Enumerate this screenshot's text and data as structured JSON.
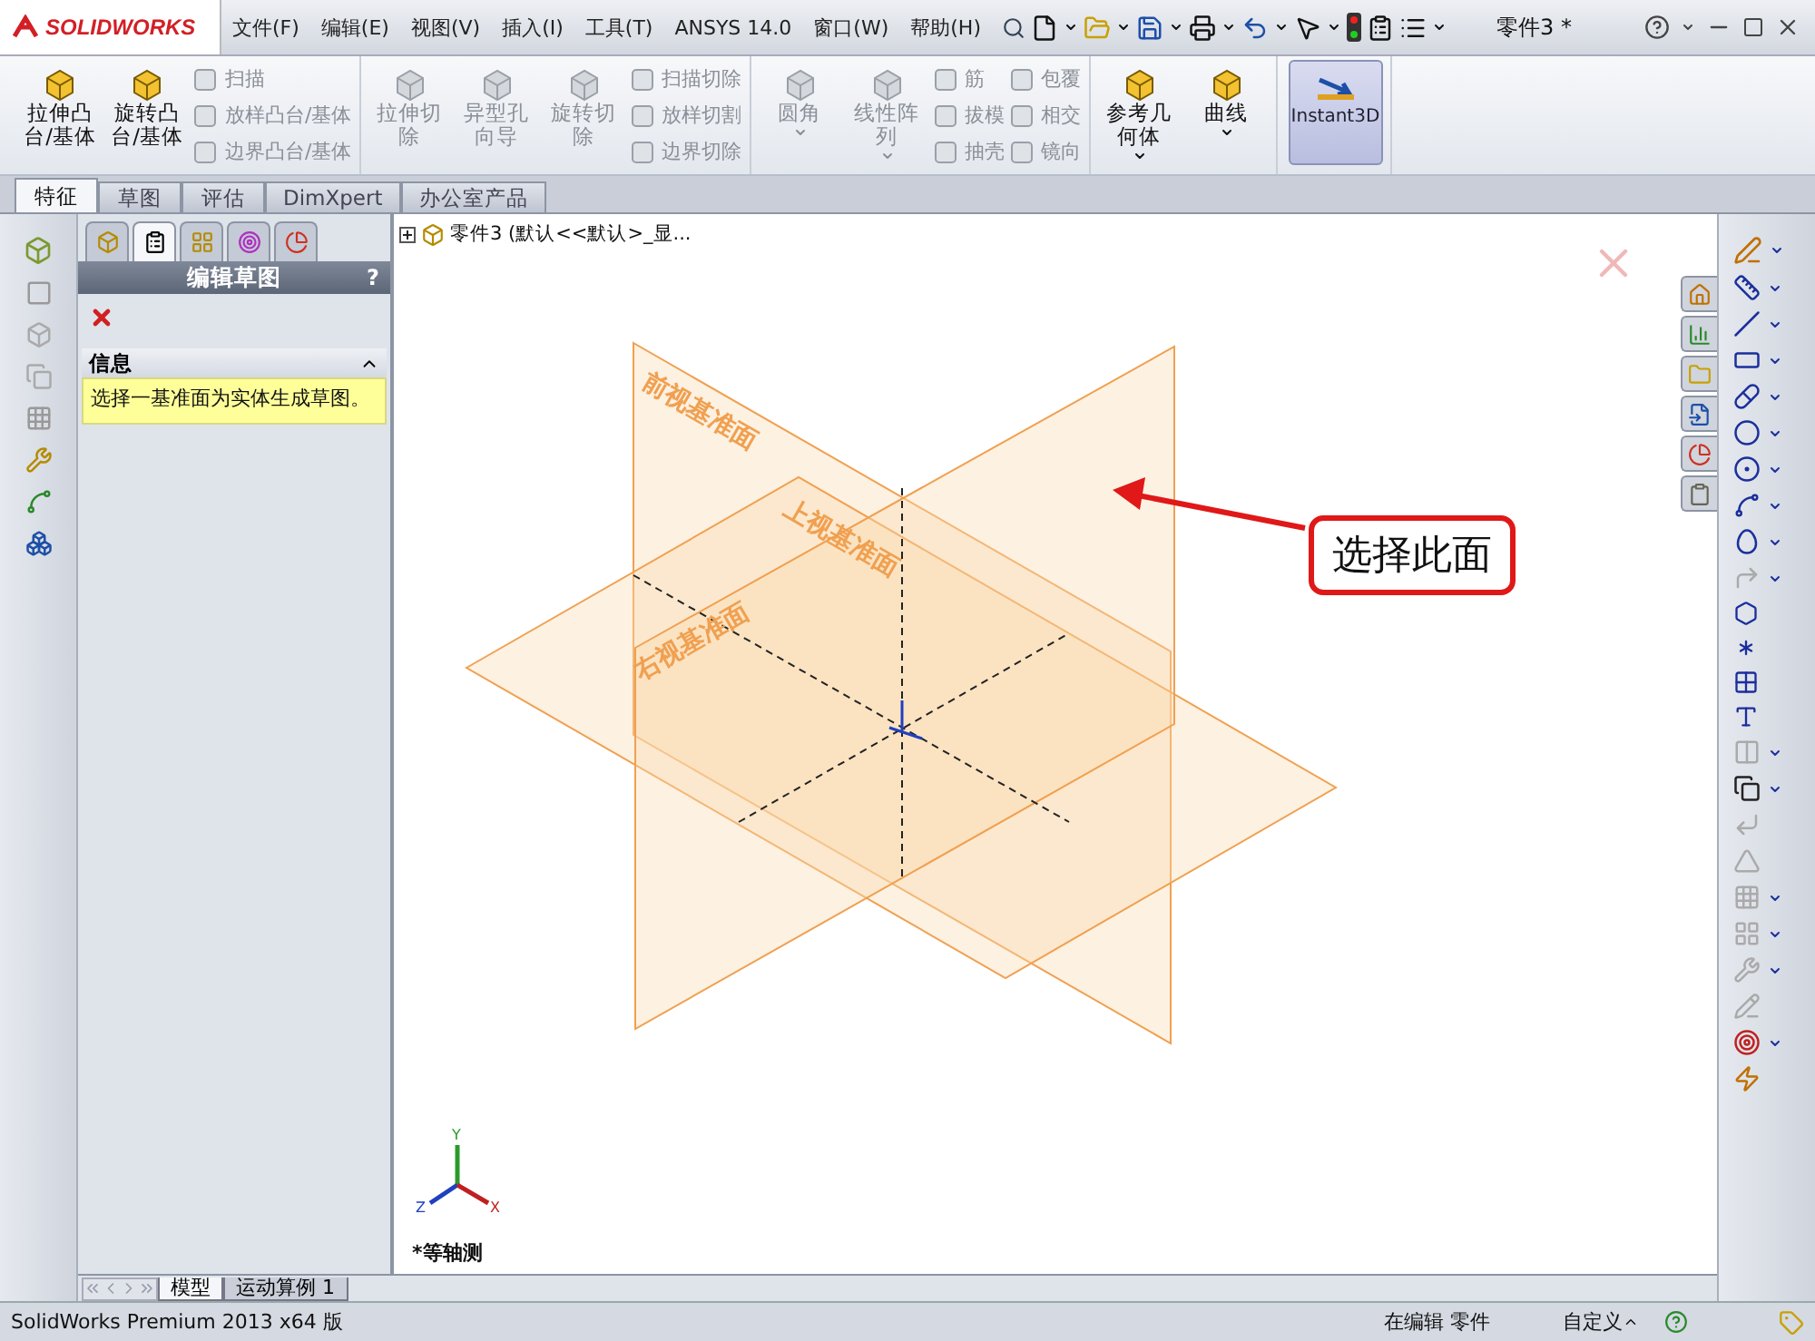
{
  "title_bar": {
    "logo": "SOLIDWORKS",
    "menus": [
      "文件(F)",
      "编辑(E)",
      "视图(V)",
      "插入(I)",
      "工具(T)",
      "ANSYS 14.0",
      "窗口(W)",
      "帮助(H)"
    ],
    "document_title": "零件3 *"
  },
  "ribbon": {
    "groups": [
      {
        "items": [
          {
            "kind": "large",
            "label": "拉伸凸台/基体",
            "disabled": false,
            "dropdown": false
          },
          {
            "kind": "large",
            "label": "旋转凸台/基体",
            "disabled": false,
            "dropdown": false
          },
          {
            "kind": "stack",
            "items": [
              {
                "label": "扫描",
                "disabled": true
              },
              {
                "label": "放样凸台/基体",
                "disabled": true
              },
              {
                "label": "边界凸台/基体",
                "disabled": true
              }
            ]
          }
        ]
      },
      {
        "items": [
          {
            "kind": "large",
            "label": "拉伸切除",
            "disabled": true,
            "dropdown": false
          },
          {
            "kind": "large",
            "label": "异型孔向导",
            "disabled": true,
            "dropdown": false
          },
          {
            "kind": "large",
            "label": "旋转切除",
            "disabled": true,
            "dropdown": false
          },
          {
            "kind": "stack",
            "items": [
              {
                "label": "扫描切除",
                "disabled": true
              },
              {
                "label": "放样切割",
                "disabled": true
              },
              {
                "label": "边界切除",
                "disabled": true
              }
            ]
          }
        ]
      },
      {
        "items": [
          {
            "kind": "large",
            "label": "圆角",
            "disabled": true,
            "dropdown": true
          },
          {
            "kind": "large",
            "label": "线性阵列",
            "disabled": true,
            "dropdown": true
          },
          {
            "kind": "stack",
            "items": [
              {
                "label": "筋",
                "disabled": true
              },
              {
                "label": "拔模",
                "disabled": true
              },
              {
                "label": "抽壳",
                "disabled": true
              }
            ]
          },
          {
            "kind": "stack",
            "items": [
              {
                "label": "包覆",
                "disabled": true
              },
              {
                "label": "相交",
                "disabled": true
              },
              {
                "label": "镜向",
                "disabled": true
              }
            ]
          }
        ]
      },
      {
        "items": [
          {
            "kind": "large",
            "label": "参考几何体",
            "disabled": false,
            "dropdown": true
          },
          {
            "kind": "large",
            "label": "曲线",
            "disabled": false,
            "dropdown": true
          }
        ]
      },
      {
        "items": [
          {
            "kind": "toggle",
            "label": "Instant3D",
            "selected": true
          }
        ]
      }
    ]
  },
  "command_tabs": [
    {
      "label": "特征",
      "selected": true
    },
    {
      "label": "草图",
      "selected": false
    },
    {
      "label": "评估",
      "selected": false
    },
    {
      "label": "DimXpert",
      "selected": false
    },
    {
      "label": "办公室产品",
      "selected": false
    }
  ],
  "manager_tabs": [
    {
      "selected": false
    },
    {
      "selected": true
    },
    {
      "selected": false
    },
    {
      "selected": false
    },
    {
      "selected": false
    }
  ],
  "property_manager": {
    "title": "编辑草图",
    "help": "?",
    "info": {
      "title": "信息",
      "expanded": true,
      "message": "选择一基准面为实体生成草图。"
    }
  },
  "feature_tree": {
    "root": "零件3 (默认<<默认>_显...",
    "expanded": false
  },
  "viewport": {
    "planes": [
      {
        "kind": "front",
        "label": "前视基准面"
      },
      {
        "kind": "top",
        "label": "上视基准面"
      },
      {
        "kind": "right",
        "label": "右视基准面"
      }
    ],
    "callout": "选择此面",
    "triad": {
      "y": "Y",
      "z": "Z",
      "x": "X"
    },
    "view_name": "*等轴测"
  },
  "bottom_tabs": [
    {
      "label": "模型",
      "selected": true
    },
    {
      "label": "运动算例 1",
      "selected": false
    }
  ],
  "status_bar": {
    "product": "SolidWorks Premium 2013 x64 版",
    "mode": "在编辑 零件",
    "units": "自定义"
  }
}
